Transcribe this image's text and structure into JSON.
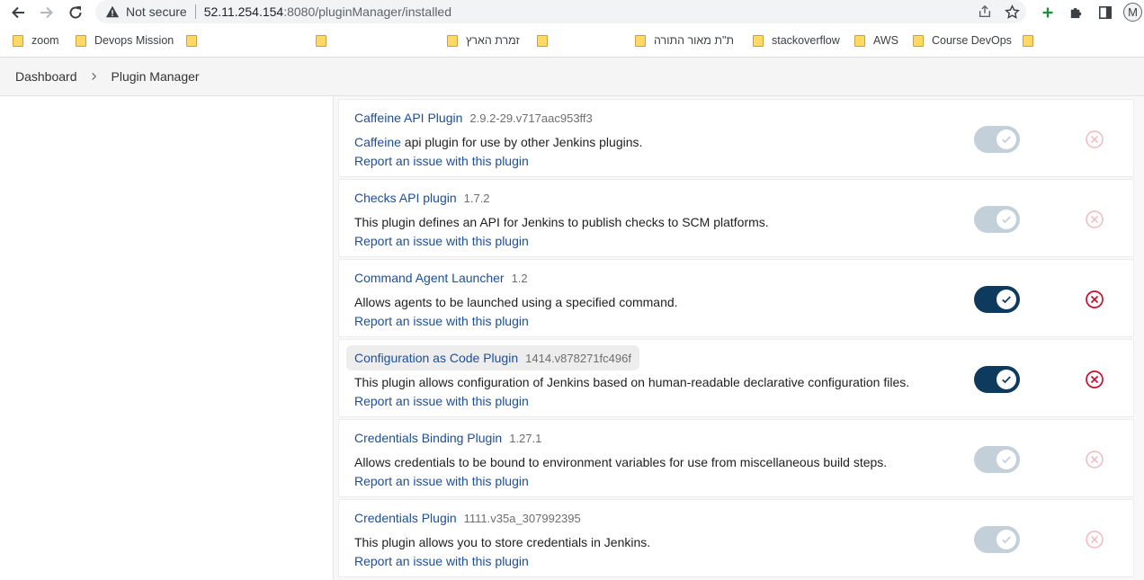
{
  "browser": {
    "not_secure": "Not secure",
    "url_host": "52.11.254.154",
    "url_path": ":8080/pluginManager/installed",
    "avatar_letter": "M",
    "bookmarks": [
      "zoom",
      "Devops Mission",
      "",
      "",
      "זמרת הארץ",
      "",
      "ת\"ת מאור התורה",
      "stackoverflow",
      "AWS",
      "Course DevOps",
      ""
    ]
  },
  "breadcrumb": {
    "dashboard": "Dashboard",
    "plugin_manager": "Plugin Manager"
  },
  "plugins": [
    {
      "name": "Caffeine API Plugin",
      "version": "2.9.2-29.v717aac953ff3",
      "desc_link": "Caffeine",
      "description": " api plugin for use by other Jenkins plugins.",
      "report": "Report an issue with this plugin",
      "enabled": true,
      "toggle_locked": true
    },
    {
      "name": "Checks API plugin",
      "version": "1.7.2",
      "desc_link": "",
      "description": "This plugin defines an API for Jenkins to publish checks to SCM platforms.",
      "report": "Report an issue with this plugin",
      "enabled": true,
      "toggle_locked": true
    },
    {
      "name": "Command Agent Launcher",
      "version": "1.2",
      "desc_link": "",
      "description": "Allows agents to be launched using a specified command.",
      "report": "Report an issue with this plugin",
      "enabled": true,
      "toggle_locked": false
    },
    {
      "name": "Configuration as Code Plugin",
      "version": "1414.v878271fc496f",
      "desc_link": "",
      "description": "This plugin allows configuration of Jenkins based on human-readable declarative configuration files.",
      "report": "Report an issue with this plugin",
      "enabled": true,
      "toggle_locked": false
    },
    {
      "name": "Credentials Binding Plugin",
      "version": "1.27.1",
      "desc_link": "",
      "description": "Allows credentials to be bound to environment variables for use from miscellaneous build steps.",
      "report": "Report an issue with this plugin",
      "enabled": true,
      "toggle_locked": true
    },
    {
      "name": "Credentials Plugin",
      "version": "1111.v35a_307992395",
      "desc_link": "",
      "description": "This plugin allows you to store credentials in Jenkins.",
      "report": "Report an issue with this plugin",
      "enabled": true,
      "toggle_locked": true
    }
  ],
  "colors": {
    "link": "#1c4f99",
    "toggle_on": "#0e3a5e",
    "toggle_locked": "#c3cfd9",
    "uninstall_active": "#c8102e",
    "uninstall_disabled": "#f2b8c0"
  }
}
